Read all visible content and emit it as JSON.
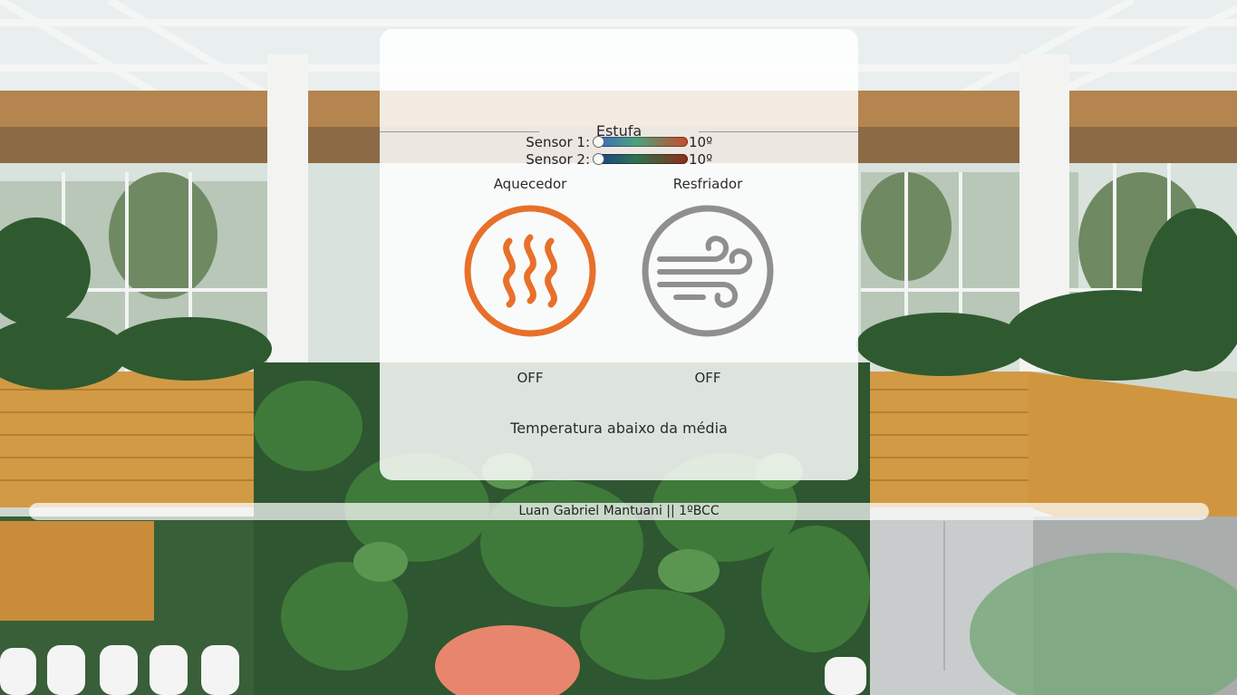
{
  "card": {
    "title": "Estufa",
    "sensors": [
      {
        "label": "Sensor 1:",
        "value": "10º",
        "level": 0.0
      },
      {
        "label": "Sensor 2:",
        "value": "10º",
        "level": 0.0
      }
    ],
    "devices": {
      "heater": {
        "name": "Aquecedor",
        "status": "OFF",
        "icon": "heat-waves-icon",
        "color": "#e8702a"
      },
      "cooler": {
        "name": "Resfriador",
        "status": "OFF",
        "icon": "wind-icon",
        "color": "#8f8f8f"
      }
    },
    "message": "Temperatura abaixo da média"
  },
  "footer": {
    "text": "Luan Gabriel Mantuani || 1ºBCC"
  }
}
